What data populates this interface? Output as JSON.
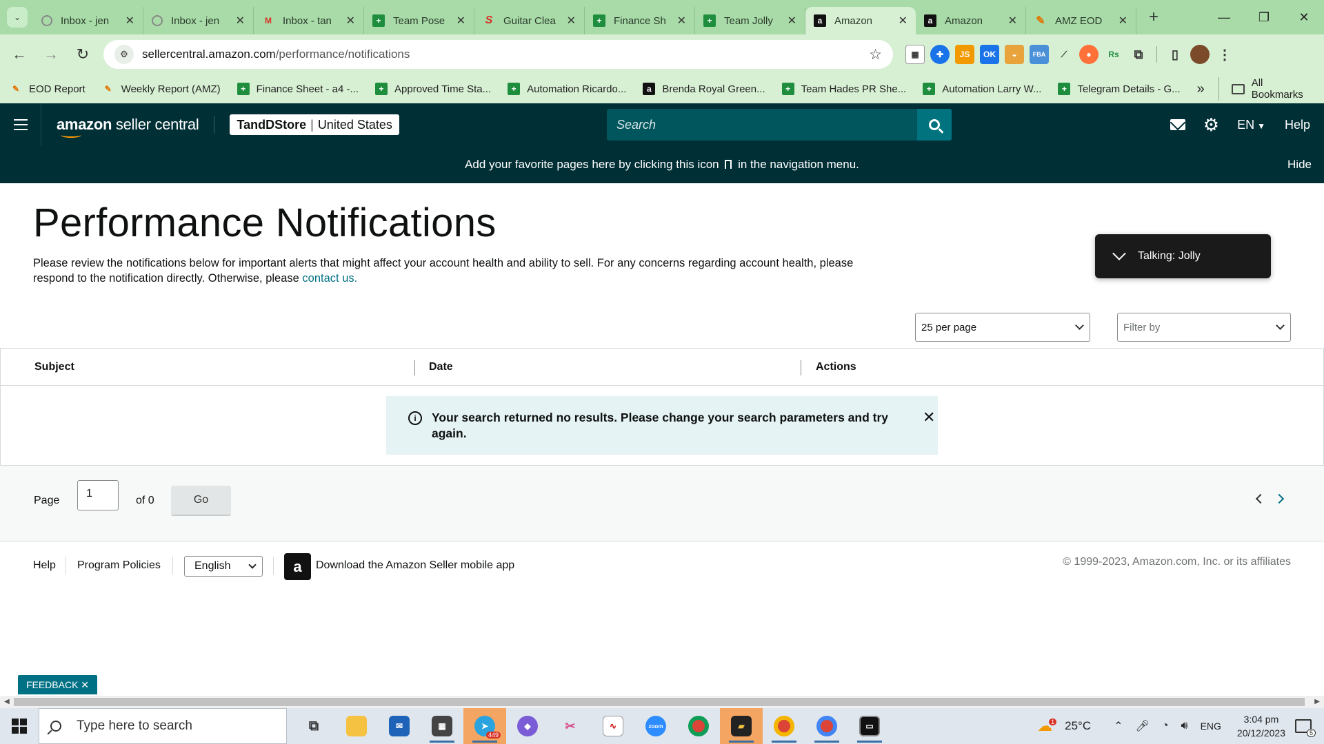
{
  "browser": {
    "tabs": [
      {
        "title": "Inbox - jen",
        "favicon": "gmail-icon",
        "active": false
      },
      {
        "title": "Inbox - jen",
        "favicon": "gmail-icon",
        "active": false
      },
      {
        "title": "Inbox - tan",
        "favicon": "gmail-m-icon",
        "active": false
      },
      {
        "title": "Team Pose",
        "favicon": "sheets-icon",
        "active": false
      },
      {
        "title": "Guitar Clea",
        "favicon": "s-logo-icon",
        "active": false
      },
      {
        "title": "Finance Sh",
        "favicon": "sheets-icon",
        "active": false
      },
      {
        "title": "Team Jolly",
        "favicon": "sheets-icon",
        "active": false
      },
      {
        "title": "Amazon",
        "favicon": "amazon-icon",
        "active": true
      },
      {
        "title": "Amazon",
        "favicon": "amazon-icon",
        "active": false
      },
      {
        "title": "AMZ EOD",
        "favicon": "clockify-icon",
        "active": false
      }
    ],
    "url_domain": "sellercentral.amazon.com",
    "url_path": "/performance/notifications",
    "bookmarks": [
      {
        "label": "EOD Report",
        "favicon": "clockify-icon"
      },
      {
        "label": "Weekly Report (AMZ)",
        "favicon": "clockify-icon"
      },
      {
        "label": "Finance Sheet - a4 -...",
        "favicon": "sheets-icon"
      },
      {
        "label": "Approved Time Sta...",
        "favicon": "sheets-icon"
      },
      {
        "label": "Automation Ricardo...",
        "favicon": "sheets-icon"
      },
      {
        "label": "Brenda Royal Green...",
        "favicon": "amazon-icon"
      },
      {
        "label": "Team Hades PR She...",
        "favicon": "sheets-icon"
      },
      {
        "label": "Automation Larry W...",
        "favicon": "sheets-icon"
      },
      {
        "label": "Telegram Details - G...",
        "favicon": "sheets-icon"
      }
    ],
    "bookmarks_more": "»",
    "all_bookmarks": "All Bookmarks"
  },
  "header": {
    "logo_bold": "amazon",
    "logo_rest": " seller central",
    "store_name": "TandDStore",
    "store_region": "United States",
    "search_placeholder": "Search",
    "language": "EN",
    "help": "Help"
  },
  "banner": {
    "text_before": "Add your favorite pages here by clicking this icon",
    "text_after": "in the navigation menu.",
    "hide": "Hide"
  },
  "page": {
    "title": "Performance Notifications",
    "intro": "Please review the notifications below for important alerts that might affect your account health and ability to sell. For any concerns regarding account health, please respond to the notification directly. Otherwise, please ",
    "contact_link": "contact us.",
    "talking_widget": "Talking: Jolly",
    "per_page": "25 per page",
    "filter_placeholder": "Filter by",
    "columns": [
      "Subject",
      "Date",
      "Actions"
    ],
    "empty_message": "Your search returned no results. Please change your search parameters and try again.",
    "pager": {
      "label": "Page",
      "current": "1",
      "of": "of 0",
      "go": "Go"
    }
  },
  "footer": {
    "help": "Help",
    "program_policies": "Program Policies",
    "language": "English",
    "app_download": "Download the Amazon Seller mobile app",
    "copyright": "© 1999-2023, Amazon.com, Inc. or its affiliates"
  },
  "feedback": "FEEDBACK ✕",
  "taskbar": {
    "search_placeholder": "Type here to search",
    "telegram_badge": "449",
    "weather_badge": "1",
    "temperature": "25°C",
    "input_lang": "ENG",
    "time": "3:04 pm",
    "date": "20/12/2023",
    "notification_count": "5"
  },
  "colors": {
    "chrome_tabstrip": "#a8dba8",
    "chrome_toolbar": "#d7f0d3",
    "seller_header": "#002f36",
    "search_button": "#00737f",
    "link": "#007185",
    "alert_bg": "#e6f3f4"
  }
}
